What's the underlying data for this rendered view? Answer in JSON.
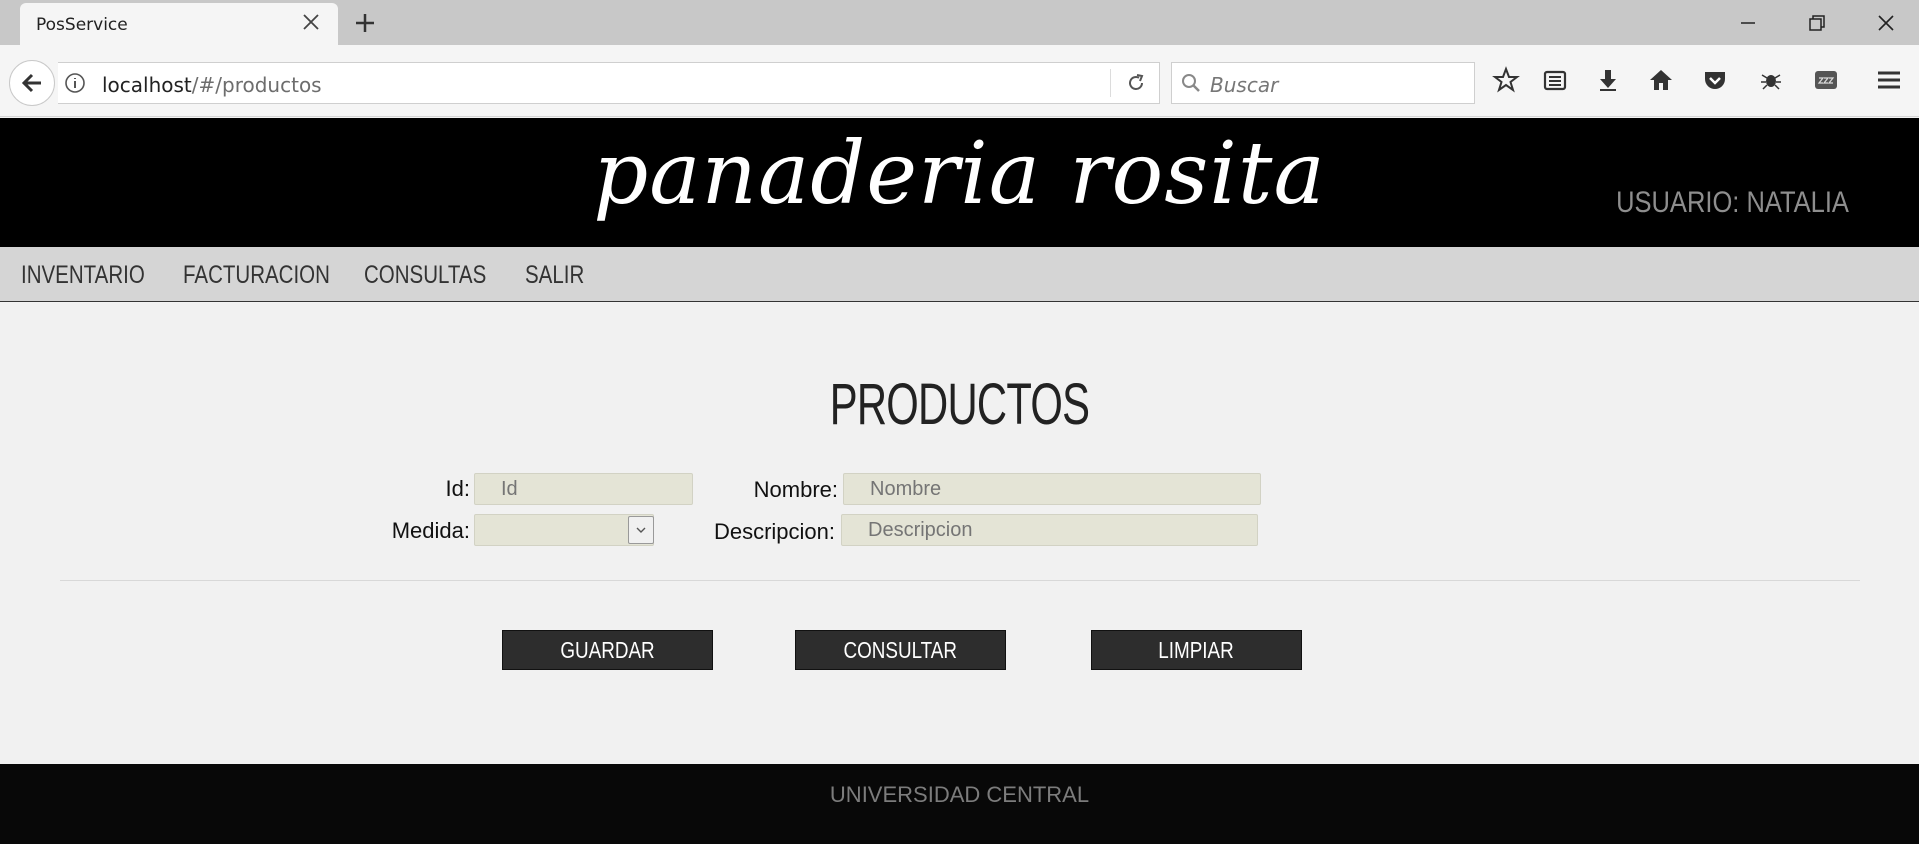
{
  "browser": {
    "tab_title": "PosService",
    "url_host": "localhost",
    "url_path": "/#/productos",
    "search_placeholder": "Buscar"
  },
  "header": {
    "logo_text": "panaderia rosita",
    "user_label": "USUARIO: NATALIA"
  },
  "menu": {
    "items": [
      "INVENTARIO",
      "FACTURACION",
      "CONSULTAS",
      "SALIR"
    ]
  },
  "form": {
    "title": "PRODUCTOS",
    "id_label": "Id:",
    "id_placeholder": "Id",
    "nombre_label": "Nombre:",
    "nombre_placeholder": "Nombre",
    "medida_label": "Medida:",
    "medida_value": "",
    "descripcion_label": "Descripcion:",
    "descripcion_placeholder": "Descripcion"
  },
  "buttons": {
    "guardar": "GUARDAR",
    "consultar": "CONSULTAR",
    "limpiar": "LIMPIAR"
  },
  "footer": {
    "text": "UNIVERSIDAD CENTRAL"
  },
  "colors": {
    "header_bg": "#000000",
    "menu_bg": "#d5d5d5",
    "button_bg": "#2d2d2d",
    "field_bg": "#e4e4d6",
    "footer_bg": "#080808"
  }
}
